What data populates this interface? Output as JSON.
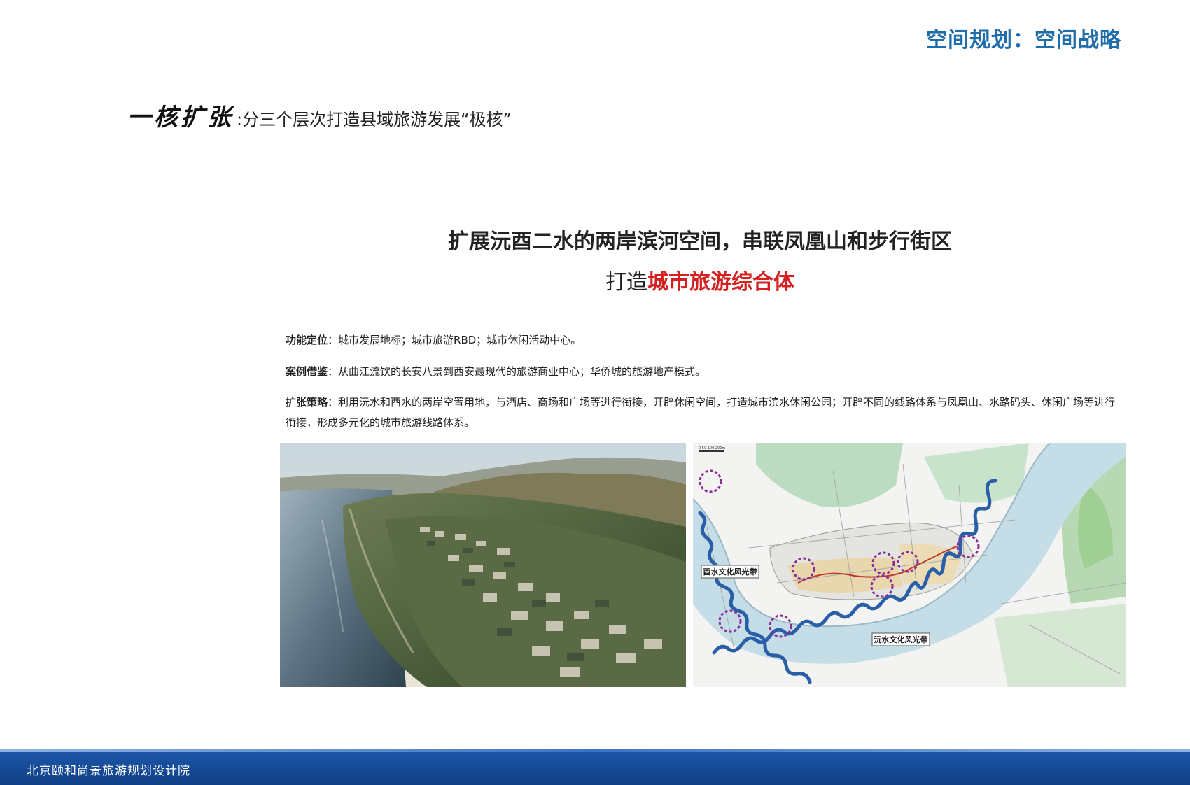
{
  "header": {
    "title": "空间规划：空间战略"
  },
  "section": {
    "calligraphy_title": "一核扩张",
    "description": ":分三个层次打造县域旅游发展“极核”"
  },
  "headline": {
    "line1": "扩展沅酉二水的两岸滨河空间，串联凤凰山和步行街区",
    "line2_prefix": "打造",
    "line2_highlight": "城市旅游综合体"
  },
  "paragraphs": {
    "function_label": "功能定位",
    "function_text": "：城市发展地标；城市旅游RBD；城市休闲活动中心。",
    "case_label": "案例借鉴",
    "case_text": "：从曲江流饮的长安八景到西安最现代的旅游商业中心；华侨城的旅游地产模式。",
    "strategy_label": "扩张策略",
    "strategy_text": "：利用沅水和酉水的两岸空置用地，与酒店、商场和广场等进行衔接，开辟休闲空间，打造城市滨水休闲公园；开辟不同的线路体系与凤凰山、水路码头、休闲广场等进行衔接，形成多元化的城市旅游线路体系。"
  },
  "map": {
    "label_youshui": "酉水文化风光带",
    "label_yuanshui": "沅水文化风光带",
    "scale_text": "0 50 100 200m"
  },
  "colors": {
    "header_blue": "#1f6eab",
    "highlight_red": "#d42020",
    "river_blue": "#2a5fa8",
    "zone_purple": "#8a2c9a",
    "footer_blue": "#1c56a8"
  },
  "footer": {
    "org": "北京颐和尚景旅游规划设计院"
  }
}
